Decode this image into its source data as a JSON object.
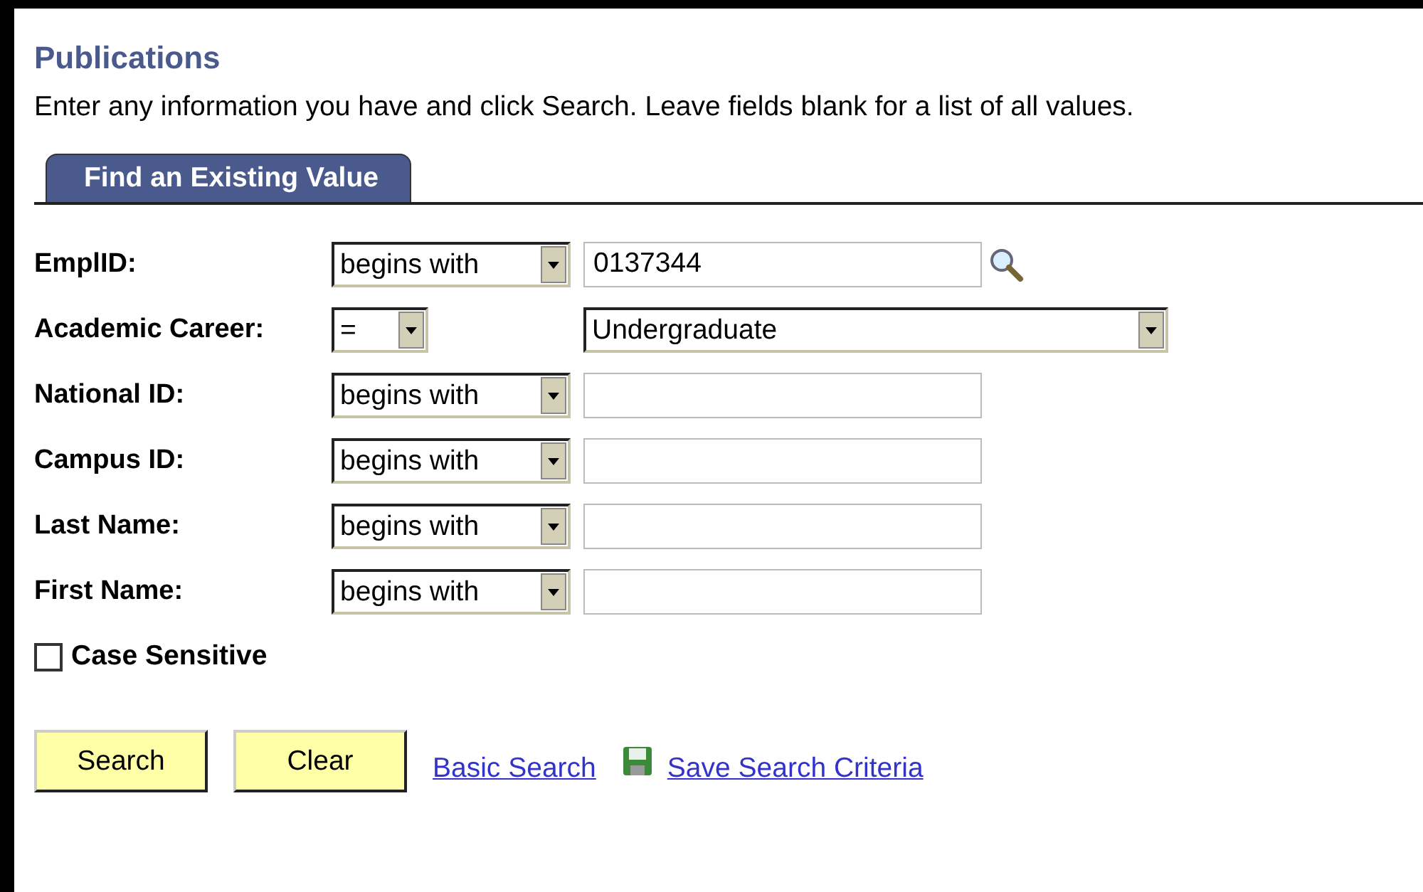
{
  "page": {
    "title": "Publications",
    "instructions": "Enter any information you have and click Search. Leave fields blank for a list of all values."
  },
  "tabs": [
    {
      "label": "Find an Existing Value",
      "selected": true
    }
  ],
  "fields": [
    {
      "label": "EmplID:",
      "operator": "begins with",
      "kind": "text",
      "value": "0137344",
      "lookup": true
    },
    {
      "label": "Academic Career:",
      "operator": "=",
      "kind": "dropdown",
      "value": "Undergraduate",
      "lookup": false
    },
    {
      "label": "National ID:",
      "operator": "begins with",
      "kind": "text",
      "lookup": false
    },
    {
      "label": "Campus ID:",
      "operator": "begins with",
      "kind": "text",
      "lookup": false
    },
    {
      "label": "Last Name:",
      "operator": "begins with",
      "kind": "text",
      "lookup": false
    },
    {
      "label": "First Name:",
      "operator": "begins with",
      "kind": "text",
      "lookup": false
    }
  ],
  "case_sensitive": {
    "label": "Case Sensitive",
    "checked": false
  },
  "buttons": [
    "Search",
    "Clear"
  ],
  "links": [
    {
      "label": "Basic Search",
      "icon": false
    },
    {
      "label": "Save Search Criteria",
      "icon": true
    }
  ]
}
